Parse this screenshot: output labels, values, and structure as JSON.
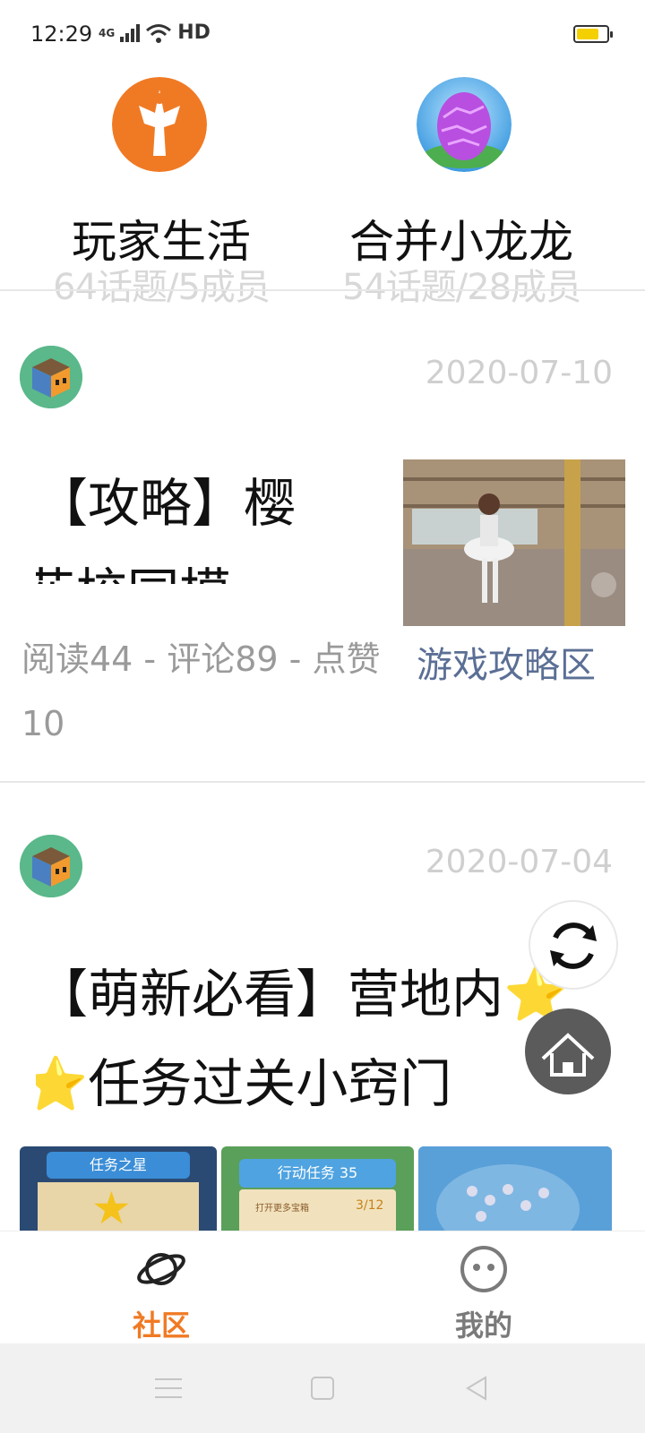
{
  "status_bar": {
    "time": "12:29",
    "network": "4G",
    "hd": "HD",
    "battery_level": 0.75
  },
  "groups": [
    {
      "name": "玩家生活",
      "meta": "64话题/5成员",
      "icon": "sword-logo-icon",
      "color": "#f07a24"
    },
    {
      "name": "合并小龙龙",
      "meta": "54话题/28成员",
      "icon": "dragon-egg-icon",
      "color": "#b84fe0"
    }
  ],
  "posts": [
    {
      "date": "2020-07-10",
      "title_line1": "【攻略】樱",
      "title_line2": "花校园模…",
      "stats": "阅读44 - 评论89 - 点赞10",
      "category": "游戏攻略区"
    },
    {
      "date": "2020-07-04",
      "title_line1": "【萌新必看】营地内⭐",
      "title_line2": "⭐任务过关小窍门",
      "thumb_texts": [
        "任务之星",
        "行动任务 35",
        "打开更多宝箱",
        "3/12"
      ]
    }
  ],
  "nav": [
    {
      "label": "社区",
      "icon": "planet-icon",
      "active": true
    },
    {
      "label": "我的",
      "icon": "smiley-face-icon",
      "active": false
    }
  ],
  "colors": {
    "accent": "#f07a24",
    "category": "#5b6f95",
    "inactive": "#7a7a7a"
  }
}
